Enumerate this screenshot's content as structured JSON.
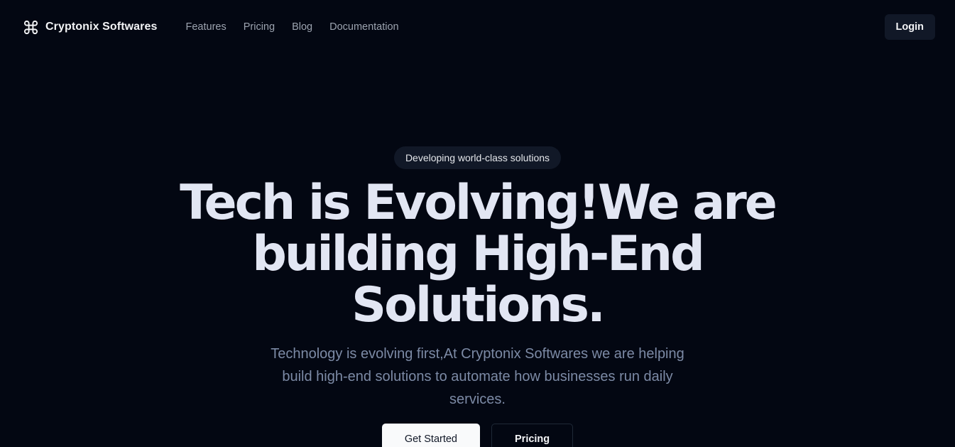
{
  "nav": {
    "brand": {
      "name": "Cryptonix Softwares",
      "icon": "command-icon"
    },
    "links": [
      {
        "label": "Features"
      },
      {
        "label": "Pricing"
      },
      {
        "label": "Blog"
      },
      {
        "label": "Documentation"
      }
    ],
    "login_label": "Login"
  },
  "hero": {
    "badge": "Developing world-class solutions",
    "headline": {
      "line1": "Tech is Evolving!We are",
      "line2": "building High-End Solutions."
    },
    "subtext": {
      "line1": "Technology is evolving first,At Cryptonix Softwares we are helping",
      "line2": "build high-end solutions to automate how businesses run daily",
      "line3": "services."
    },
    "primary_cta": "Get Started",
    "secondary_cta": "Pricing"
  },
  "colors": {
    "background": "#030712",
    "surface": "#111827",
    "headline": "#e2e6f3",
    "muted_text": "#7c8aa5",
    "primary_button": "#f9fafb"
  }
}
